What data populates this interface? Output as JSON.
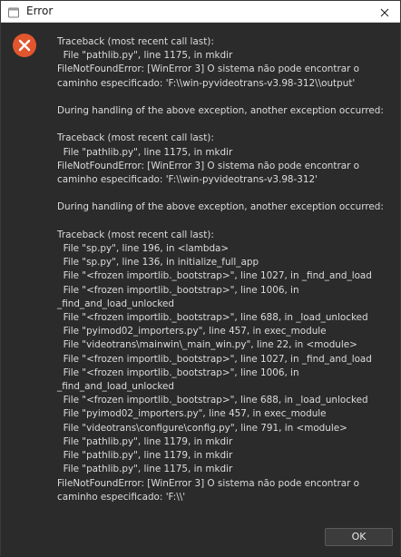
{
  "window": {
    "title": "Error",
    "title_icon": "app-window-icon",
    "close_icon": "close-icon"
  },
  "dialog": {
    "icon": "error-icon",
    "message": "Traceback (most recent call last):\n  File \"pathlib.py\", line 1175, in mkdir\nFileNotFoundError: [WinError 3] O sistema não pode encontrar o caminho especificado: 'F:\\\\win-pyvideotrans-v3.98-312\\\\output'\n\nDuring handling of the above exception, another exception occurred:\n\nTraceback (most recent call last):\n  File \"pathlib.py\", line 1175, in mkdir\nFileNotFoundError: [WinError 3] O sistema não pode encontrar o caminho especificado: 'F:\\\\win-pyvideotrans-v3.98-312'\n\nDuring handling of the above exception, another exception occurred:\n\nTraceback (most recent call last):\n  File \"sp.py\", line 196, in <lambda>\n  File \"sp.py\", line 136, in initialize_full_app\n  File \"<frozen importlib._bootstrap>\", line 1027, in _find_and_load\n  File \"<frozen importlib._bootstrap>\", line 1006, in _find_and_load_unlocked\n  File \"<frozen importlib._bootstrap>\", line 688, in _load_unlocked\n  File \"pyimod02_importers.py\", line 457, in exec_module\n  File \"videotrans\\mainwin\\_main_win.py\", line 22, in <module>\n  File \"<frozen importlib._bootstrap>\", line 1027, in _find_and_load\n  File \"<frozen importlib._bootstrap>\", line 1006, in _find_and_load_unlocked\n  File \"<frozen importlib._bootstrap>\", line 688, in _load_unlocked\n  File \"pyimod02_importers.py\", line 457, in exec_module\n  File \"videotrans\\configure\\config.py\", line 791, in <module>\n  File \"pathlib.py\", line 1179, in mkdir\n  File \"pathlib.py\", line 1179, in mkdir\n  File \"pathlib.py\", line 1175, in mkdir\nFileNotFoundError: [WinError 3] O sistema não pode encontrar o caminho especificado: 'F:\\\\'",
    "ok_label": "OK"
  },
  "colors": {
    "error_red": "#e2562e",
    "background": "#2b2b2b",
    "text": "#dcdcdc"
  }
}
